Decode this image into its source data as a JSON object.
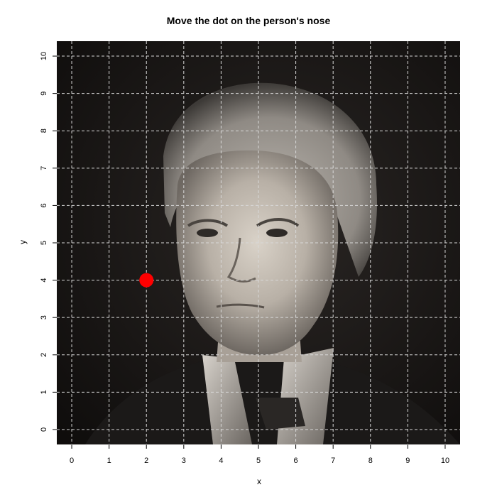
{
  "chart_data": {
    "type": "scatter",
    "title": "Move the dot on the person's nose",
    "xlabel": "x",
    "ylabel": "y",
    "xlim": [
      -0.4,
      10.4
    ],
    "ylim": [
      -0.4,
      10.4
    ],
    "x_ticks": [
      0,
      1,
      2,
      3,
      4,
      5,
      6,
      7,
      8,
      9,
      10
    ],
    "y_ticks": [
      0,
      1,
      2,
      3,
      4,
      5,
      6,
      7,
      8,
      9,
      10
    ],
    "grid": true,
    "grid_style": "dashed",
    "background": "black-and-white portrait photograph of an elderly woman",
    "series": [
      {
        "x": [
          2
        ],
        "y": [
          4
        ],
        "color": "#ff0000"
      }
    ]
  }
}
